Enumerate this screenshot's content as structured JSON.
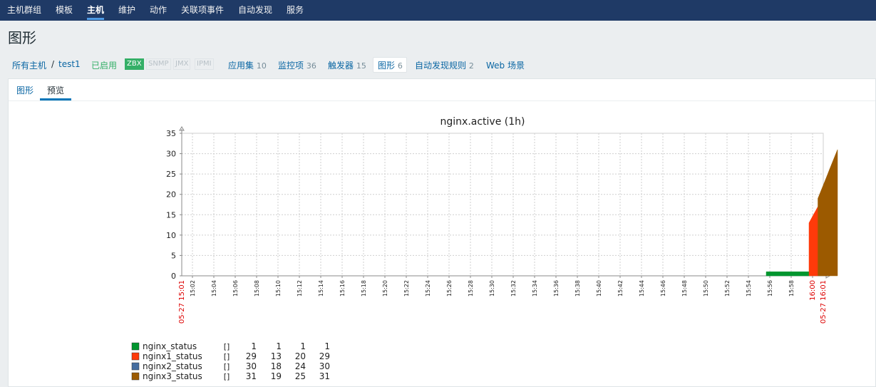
{
  "nav": {
    "items": [
      {
        "label": "主机群组"
      },
      {
        "label": "模板"
      },
      {
        "label": "主机"
      },
      {
        "label": "维护"
      },
      {
        "label": "动作"
      },
      {
        "label": "关联项事件"
      },
      {
        "label": "自动发现"
      },
      {
        "label": "服务"
      }
    ],
    "active": "主机"
  },
  "page_title": "图形",
  "breadcrumb": {
    "all_hosts": "所有主机",
    "separator": "/",
    "host": "test1",
    "status": "已启用",
    "availability": [
      "ZBX",
      "SNMP",
      "JMX",
      "IPMI"
    ],
    "links": [
      {
        "label": "应用集",
        "count": "10"
      },
      {
        "label": "监控项",
        "count": "36"
      },
      {
        "label": "触发器",
        "count": "15"
      },
      {
        "label": "图形",
        "count": "6"
      },
      {
        "label": "自动发现规则",
        "count": "2"
      },
      {
        "label": "Web 场景",
        "count": ""
      }
    ]
  },
  "tabs": [
    {
      "label": "图形"
    },
    {
      "label": "预览"
    }
  ],
  "colors": {
    "nav_bg": "#1f3a66",
    "link": "#0a66a3",
    "enabled": "#34af67",
    "bg": "#ebeef0"
  },
  "chart_data": {
    "type": "area",
    "title": "nginx.active (1h)",
    "ylim": [
      0,
      35
    ],
    "yticks": [
      "35",
      "30",
      "25",
      "20",
      "15",
      "10",
      "5",
      "0"
    ],
    "xticks": [
      "15:02",
      "15:04",
      "15:06",
      "15:08",
      "15:10",
      "15:12",
      "15:14",
      "15:16",
      "15:18",
      "15:20",
      "15:22",
      "15:24",
      "15:26",
      "15:28",
      "15:30",
      "15:32",
      "15:34",
      "15:36",
      "15:38",
      "15:40",
      "15:42",
      "15:44",
      "15:46",
      "15:48",
      "15:50",
      "15:52",
      "15:54",
      "15:56",
      "15:58",
      "16:00"
    ],
    "x_start_label": "05-27 15:01",
    "x_end_label": "05-27 16:01",
    "grid": true,
    "legend_header": [
      "",
      "",
      "",
      ""
    ],
    "series": [
      {
        "name": "nginx_status",
        "color": "#00962f",
        "func": "[]",
        "stats": [
          "1",
          "1",
          "1",
          "1"
        ],
        "x_from": "15:55:40",
        "x_to": "15:59:40",
        "values": [
          1,
          1
        ]
      },
      {
        "name": "nginx1_status",
        "color": "#ff3a0a",
        "func": "[]",
        "stats": [
          "29",
          "13",
          "20",
          "29"
        ],
        "x_from": "15:59:40",
        "x_to": "16:00:30",
        "values": [
          13,
          14,
          15,
          16,
          17
        ]
      },
      {
        "name": "nginx2_status",
        "color": "#446da0",
        "func": "[]",
        "stats": [
          "30",
          "18",
          "24",
          "30"
        ],
        "x_from": "",
        "x_to": "",
        "values": []
      },
      {
        "name": "nginx3_status",
        "color": "#9c5a00",
        "func": "[]",
        "stats": [
          "31",
          "19",
          "25",
          "31"
        ],
        "x_from": "16:00:30",
        "x_to": "16:02:20",
        "values": [
          19,
          20,
          21,
          22,
          23,
          24,
          25,
          26,
          27,
          28,
          29,
          30,
          31
        ]
      }
    ]
  }
}
